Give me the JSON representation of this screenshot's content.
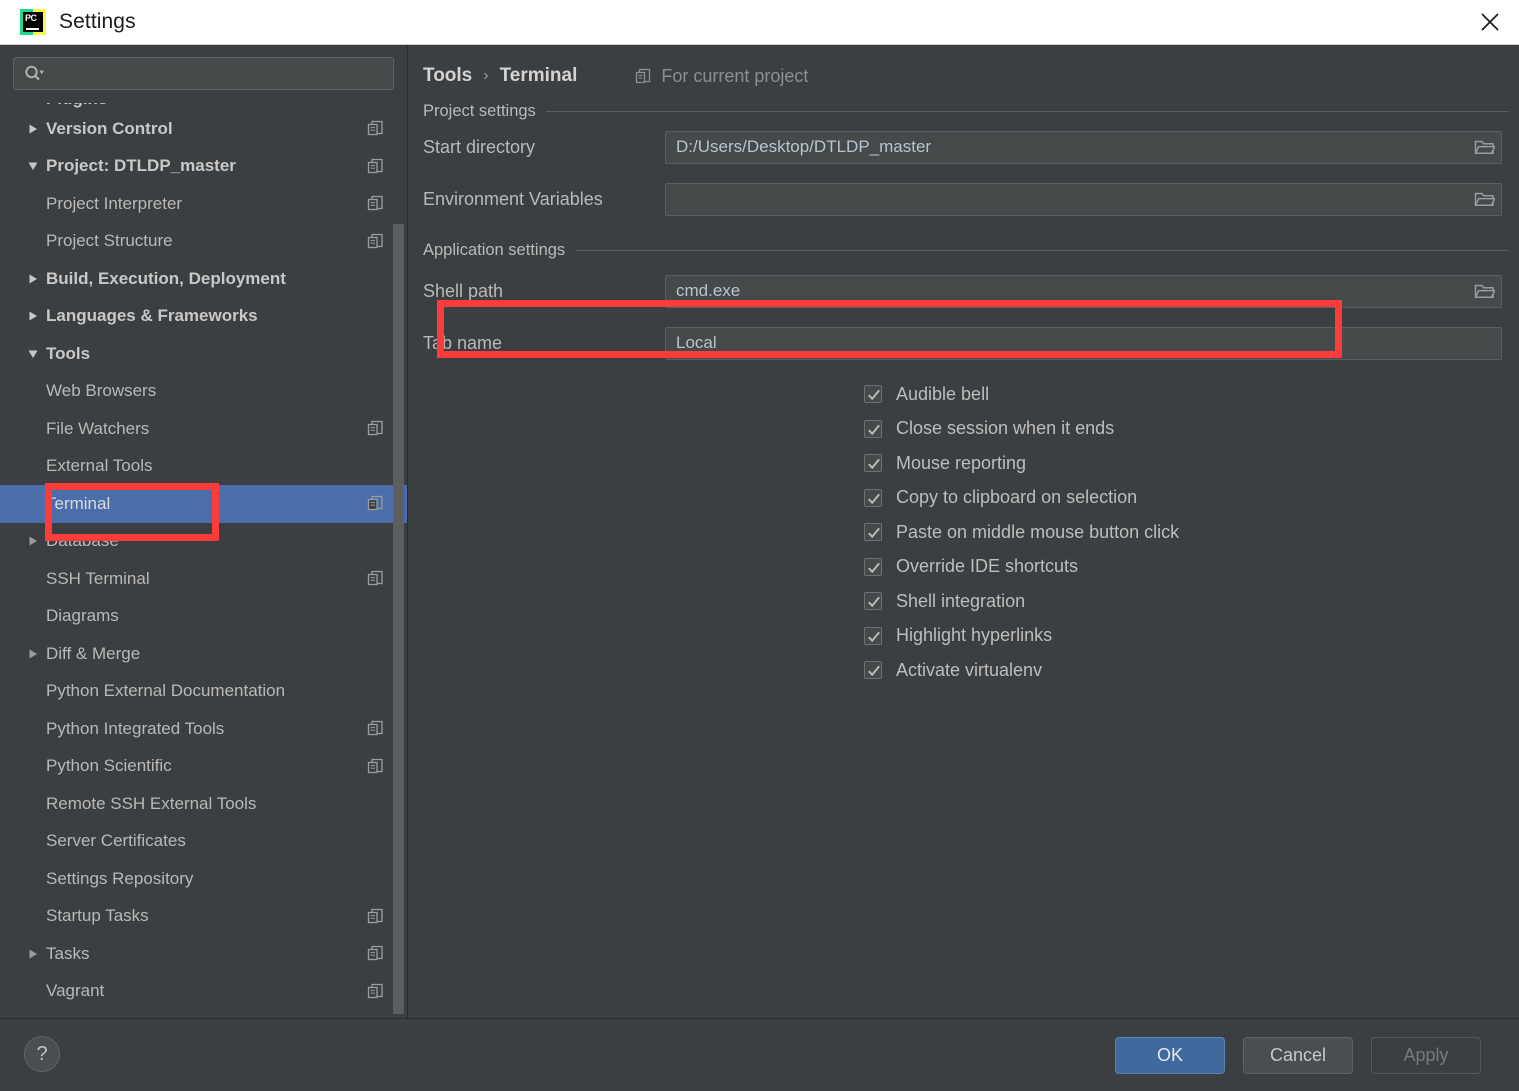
{
  "window": {
    "title": "Settings",
    "logo_text": "PC",
    "close_icon": "close-icon"
  },
  "sidebar": {
    "search": {
      "placeholder": "",
      "value": "",
      "icon": "search-icon",
      "dropdown_icon": "chevron-down-icon"
    },
    "items": [
      {
        "label": "Plugins",
        "level": 1,
        "arrow": "none",
        "bold": true,
        "copy": false,
        "selected": false,
        "clipped": true
      },
      {
        "label": "Version Control",
        "level": 1,
        "arrow": "collapsed",
        "bold": true,
        "copy": true,
        "selected": false
      },
      {
        "label": "Project: DTLDP_master",
        "level": 1,
        "arrow": "expanded",
        "bold": true,
        "copy": true,
        "selected": false
      },
      {
        "label": "Project Interpreter",
        "level": 2,
        "arrow": "none",
        "bold": false,
        "copy": true,
        "selected": false
      },
      {
        "label": "Project Structure",
        "level": 2,
        "arrow": "none",
        "bold": false,
        "copy": true,
        "selected": false
      },
      {
        "label": "Build, Execution, Deployment",
        "level": 1,
        "arrow": "collapsed",
        "bold": true,
        "copy": false,
        "selected": false
      },
      {
        "label": "Languages & Frameworks",
        "level": 1,
        "arrow": "collapsed",
        "bold": true,
        "copy": false,
        "selected": false
      },
      {
        "label": "Tools",
        "level": 1,
        "arrow": "expanded",
        "bold": true,
        "copy": false,
        "selected": false
      },
      {
        "label": "Web Browsers",
        "level": 2,
        "arrow": "none",
        "bold": false,
        "copy": false,
        "selected": false
      },
      {
        "label": "File Watchers",
        "level": 2,
        "arrow": "none",
        "bold": false,
        "copy": true,
        "selected": false
      },
      {
        "label": "External Tools",
        "level": 2,
        "arrow": "none",
        "bold": false,
        "copy": false,
        "selected": false
      },
      {
        "label": "Terminal",
        "level": 2,
        "arrow": "none",
        "bold": false,
        "copy": true,
        "selected": true
      },
      {
        "label": "Database",
        "level": 2,
        "arrow": "collapsed",
        "bold": false,
        "copy": false,
        "selected": false
      },
      {
        "label": "SSH Terminal",
        "level": 2,
        "arrow": "none",
        "bold": false,
        "copy": true,
        "selected": false
      },
      {
        "label": "Diagrams",
        "level": 2,
        "arrow": "none",
        "bold": false,
        "copy": false,
        "selected": false
      },
      {
        "label": "Diff & Merge",
        "level": 2,
        "arrow": "collapsed",
        "bold": false,
        "copy": false,
        "selected": false
      },
      {
        "label": "Python External Documentation",
        "level": 2,
        "arrow": "none",
        "bold": false,
        "copy": false,
        "selected": false
      },
      {
        "label": "Python Integrated Tools",
        "level": 2,
        "arrow": "none",
        "bold": false,
        "copy": true,
        "selected": false
      },
      {
        "label": "Python Scientific",
        "level": 2,
        "arrow": "none",
        "bold": false,
        "copy": true,
        "selected": false
      },
      {
        "label": "Remote SSH External Tools",
        "level": 2,
        "arrow": "none",
        "bold": false,
        "copy": false,
        "selected": false
      },
      {
        "label": "Server Certificates",
        "level": 2,
        "arrow": "none",
        "bold": false,
        "copy": false,
        "selected": false
      },
      {
        "label": "Settings Repository",
        "level": 2,
        "arrow": "none",
        "bold": false,
        "copy": false,
        "selected": false
      },
      {
        "label": "Startup Tasks",
        "level": 2,
        "arrow": "none",
        "bold": false,
        "copy": true,
        "selected": false
      },
      {
        "label": "Tasks",
        "level": 2,
        "arrow": "collapsed",
        "bold": false,
        "copy": true,
        "selected": false
      },
      {
        "label": "Vagrant",
        "level": 2,
        "arrow": "none",
        "bold": false,
        "copy": true,
        "selected": false
      }
    ]
  },
  "content": {
    "breadcrumb": {
      "root": "Tools",
      "separator": "›",
      "leaf": "Terminal",
      "scope": "For current project",
      "scope_icon": "copy-icon"
    },
    "project_settings": {
      "group_label": "Project settings",
      "fields": [
        {
          "label": "Start directory",
          "value": "D:/Users/Desktop/DTLDP_master",
          "browse_icon": "folder-icon"
        },
        {
          "label": "Environment Variables",
          "value": "",
          "browse_icon": "folder-icon"
        }
      ]
    },
    "application_settings": {
      "group_label": "Application settings",
      "fields": [
        {
          "label": "Shell path",
          "value": "cmd.exe",
          "browse_icon": "folder-icon"
        },
        {
          "label": "Tab name",
          "value": "Local",
          "browse_icon": "none"
        }
      ],
      "checkboxes": [
        {
          "label": "Audible bell",
          "checked": true
        },
        {
          "label": "Close session when it ends",
          "checked": true
        },
        {
          "label": "Mouse reporting",
          "checked": true
        },
        {
          "label": "Copy to clipboard on selection",
          "checked": true
        },
        {
          "label": "Paste on middle mouse button click",
          "checked": true
        },
        {
          "label": "Override IDE shortcuts",
          "checked": true
        },
        {
          "label": "Shell integration",
          "checked": true
        },
        {
          "label": "Highlight hyperlinks",
          "checked": true
        },
        {
          "label": "Activate virtualenv",
          "checked": true
        }
      ]
    }
  },
  "footer": {
    "help_label": "?",
    "ok_label": "OK",
    "cancel_label": "Cancel",
    "apply_label": "Apply",
    "apply_enabled": false
  },
  "annotations": [
    {
      "name": "terminal-highlight",
      "color": "#fc3b3b"
    },
    {
      "name": "shell-path-highlight",
      "color": "#fc3b3b"
    }
  ],
  "colors": {
    "panel_bg": "#3c3f41",
    "field_bg": "#45494a",
    "selection_blue": "#4b6eab",
    "primary_button": "#40699e",
    "annotation_red": "#fc3b3b",
    "titlebar_bg": "#ffffff"
  }
}
